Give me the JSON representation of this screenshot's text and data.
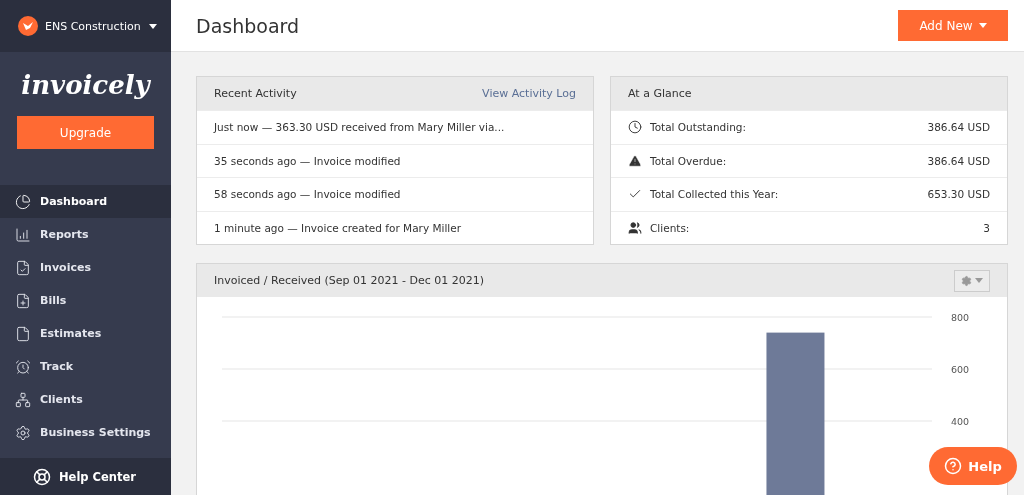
{
  "sidebar": {
    "company": "ENS Construction",
    "logo": "invoicely",
    "upgrade_button": "Upgrade",
    "items": [
      {
        "label": "Dashboard",
        "selected": true
      },
      {
        "label": "Reports",
        "selected": false
      },
      {
        "label": "Invoices",
        "selected": false
      },
      {
        "label": "Bills",
        "selected": false
      },
      {
        "label": "Estimates",
        "selected": false
      },
      {
        "label": "Track",
        "selected": false
      },
      {
        "label": "Clients",
        "selected": false
      },
      {
        "label": "Business Settings",
        "selected": false
      }
    ],
    "help_center": "Help Center"
  },
  "header": {
    "title": "Dashboard",
    "add_button": "Add New"
  },
  "recent_activity": {
    "title": "Recent Activity",
    "link": "View Activity Log",
    "rows": [
      "Just now — 363.30 USD received from Mary Miller via...",
      "35 seconds ago — Invoice modified",
      "58 seconds ago — Invoice modified",
      "1 minute ago — Invoice created for Mary Miller"
    ]
  },
  "at_a_glance": {
    "title": "At a Glance",
    "rows": [
      {
        "label": "Total Outstanding:",
        "value": "386.64 USD"
      },
      {
        "label": "Total Overdue:",
        "value": "386.64 USD"
      },
      {
        "label": "Total Collected this Year:",
        "value": "653.30 USD"
      },
      {
        "label": "Clients:",
        "value": "3"
      }
    ]
  },
  "chart_panel": {
    "title": "Invoiced / Received (Sep 01 2021 - Dec 01 2021)",
    "chart_data": {
      "type": "bar",
      "ylim": [
        0,
        800
      ],
      "yticks": [
        400,
        600,
        800
      ],
      "values": [
        null,
        null,
        null,
        null,
        null,
        null,
        null,
        null,
        null,
        null,
        740,
        null,
        null
      ]
    }
  },
  "help_button": "Help"
}
